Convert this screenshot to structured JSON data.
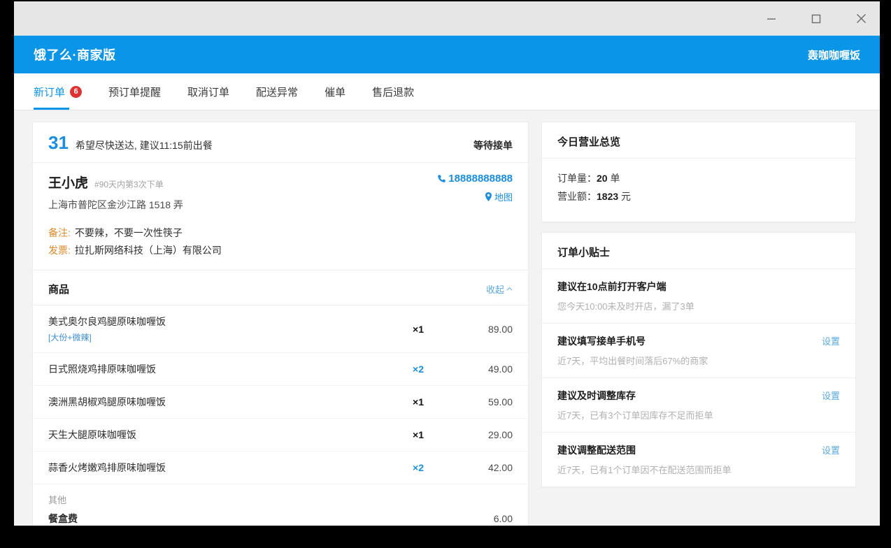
{
  "window": {
    "controls": [
      {
        "name": "minimize-button",
        "glyph": "minimize"
      },
      {
        "name": "maximize-button",
        "glyph": "maximize"
      },
      {
        "name": "close-button",
        "glyph": "close"
      }
    ]
  },
  "appbar": {
    "title": "饿了么·商家版",
    "shop_name": "轰咖咖喱饭",
    "brand_color": "#0a95e8"
  },
  "tabs": [
    {
      "label": "新订单",
      "badge": "6",
      "active": true
    },
    {
      "label": "预订单提醒",
      "badge": "",
      "active": false
    },
    {
      "label": "取消订单",
      "badge": "",
      "active": false
    },
    {
      "label": "配送异常",
      "badge": "",
      "active": false
    },
    {
      "label": "催单",
      "badge": "",
      "active": false
    },
    {
      "label": "售后退款",
      "badge": "",
      "active": false
    }
  ],
  "order": {
    "sequence": "31",
    "delivery_hint": "希望尽快送达, 建议11:15前出餐",
    "status": "等待接单",
    "customer": {
      "name": "王小虎",
      "meta": "#90天内第3次下单",
      "address": "上海市普陀区金沙江路 1518 弄",
      "phone": "18888888888",
      "map_label": "地图"
    },
    "notes": [
      {
        "label": "备注:",
        "value": "不要辣，不要一次性筷子"
      },
      {
        "label": "发票:",
        "value": "拉扎斯网络科技（上海）有限公司"
      }
    ],
    "goods": {
      "title": "商品",
      "toggle_label": "收起",
      "items": [
        {
          "name": "美式奥尔良鸡腿原味咖喱饭",
          "spec": "[大份+微辣]",
          "qty": "×1",
          "qty_highlight": false,
          "price": "89.00"
        },
        {
          "name": "日式照烧鸡排原味咖喱饭",
          "spec": "",
          "qty": "×2",
          "qty_highlight": true,
          "price": "49.00"
        },
        {
          "name": "澳洲黑胡椒鸡腿原味咖喱饭",
          "spec": "",
          "qty": "×1",
          "qty_highlight": false,
          "price": "59.00"
        },
        {
          "name": "天生大腿原味咖喱饭",
          "spec": "",
          "qty": "×1",
          "qty_highlight": false,
          "price": "29.00"
        },
        {
          "name": "蒜香火烤嫩鸡排原味咖喱饭",
          "spec": "",
          "qty": "×2",
          "qty_highlight": true,
          "price": "42.00"
        }
      ],
      "other_label": "其他",
      "fees": [
        {
          "name": "餐盒费",
          "amount": "6.00"
        }
      ]
    }
  },
  "summary": {
    "title": "今日营业总览",
    "lines": [
      {
        "label": "订单量：",
        "value": "20",
        "unit": " 单"
      },
      {
        "label": "营业额：",
        "value": "1823",
        "unit": " 元"
      }
    ]
  },
  "tips": {
    "title": "订单小贴士",
    "items": [
      {
        "title": "建议在10点前打开客户端",
        "sub": "您今天10:00未及时开店，漏了3单",
        "action": ""
      },
      {
        "title": "建议填写接单手机号",
        "sub": "近7天，平均出餐时间落后67%的商家",
        "action": "设置"
      },
      {
        "title": "建议及时调整库存",
        "sub": "近7天，已有3个订单因库存不足而拒单",
        "action": "设置"
      },
      {
        "title": "建议调整配送范围",
        "sub": "近7天，已有1个订单因不在配送范围而拒单",
        "action": "设置"
      }
    ]
  }
}
